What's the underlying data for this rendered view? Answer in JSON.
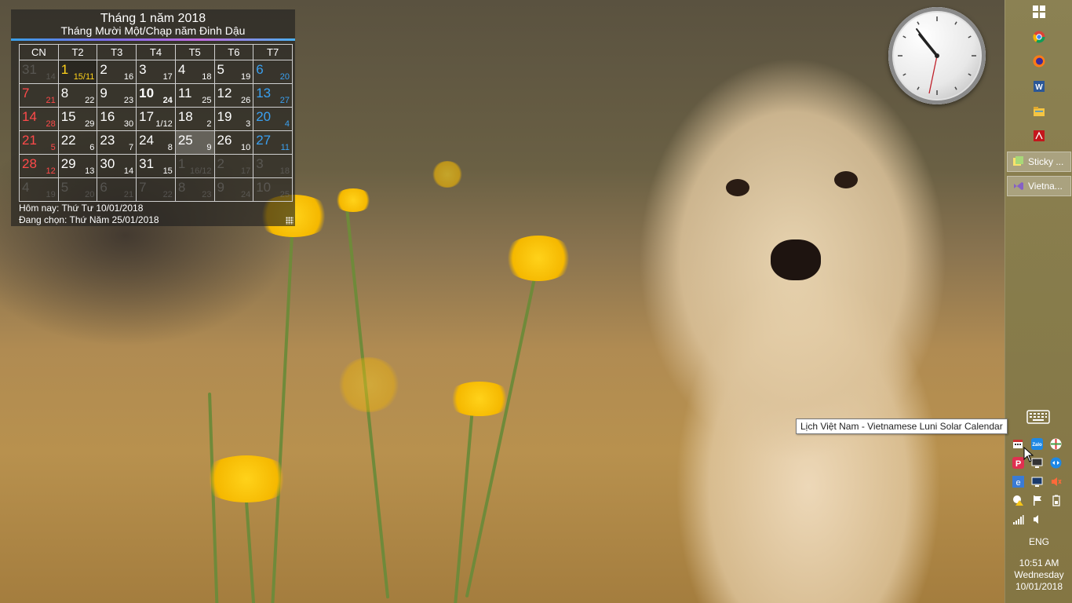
{
  "calendar": {
    "title": "Tháng 1 năm 2018",
    "subtitle": "Tháng Mười Một/Chạp năm Đinh Dậu",
    "weekdays": [
      "CN",
      "T2",
      "T3",
      "T4",
      "T5",
      "T6",
      "T7"
    ],
    "weeks": [
      [
        {
          "s": "31",
          "l": "14",
          "c": "g"
        },
        {
          "s": "1",
          "l": "15/11",
          "c": "y"
        },
        {
          "s": "2",
          "l": "16",
          "c": "w"
        },
        {
          "s": "3",
          "l": "17",
          "c": "w"
        },
        {
          "s": "4",
          "l": "18",
          "c": "w"
        },
        {
          "s": "5",
          "l": "19",
          "c": "w"
        },
        {
          "s": "6",
          "l": "20",
          "c": "b"
        }
      ],
      [
        {
          "s": "7",
          "l": "21",
          "c": "r"
        },
        {
          "s": "8",
          "l": "22",
          "c": "w"
        },
        {
          "s": "9",
          "l": "23",
          "c": "w"
        },
        {
          "s": "10",
          "l": "24",
          "c": "w"
        },
        {
          "s": "11",
          "l": "25",
          "c": "w"
        },
        {
          "s": "12",
          "l": "26",
          "c": "w"
        },
        {
          "s": "13",
          "l": "27",
          "c": "b"
        }
      ],
      [
        {
          "s": "14",
          "l": "28",
          "c": "r"
        },
        {
          "s": "15",
          "l": "29",
          "c": "w"
        },
        {
          "s": "16",
          "l": "30",
          "c": "w"
        },
        {
          "s": "17",
          "l": "1/12",
          "c": "w"
        },
        {
          "s": "18",
          "l": "2",
          "c": "w"
        },
        {
          "s": "19",
          "l": "3",
          "c": "w"
        },
        {
          "s": "20",
          "l": "4",
          "c": "b"
        }
      ],
      [
        {
          "s": "21",
          "l": "5",
          "c": "r"
        },
        {
          "s": "22",
          "l": "6",
          "c": "w"
        },
        {
          "s": "23",
          "l": "7",
          "c": "w"
        },
        {
          "s": "24",
          "l": "8",
          "c": "w"
        },
        {
          "s": "25",
          "l": "9",
          "c": "w"
        },
        {
          "s": "26",
          "l": "10",
          "c": "w"
        },
        {
          "s": "27",
          "l": "11",
          "c": "b"
        }
      ],
      [
        {
          "s": "28",
          "l": "12",
          "c": "r"
        },
        {
          "s": "29",
          "l": "13",
          "c": "w"
        },
        {
          "s": "30",
          "l": "14",
          "c": "w"
        },
        {
          "s": "31",
          "l": "15",
          "c": "w"
        },
        {
          "s": "1",
          "l": "16/12",
          "c": "g"
        },
        {
          "s": "2",
          "l": "17",
          "c": "g"
        },
        {
          "s": "3",
          "l": "18",
          "c": "g"
        }
      ],
      [
        {
          "s": "4",
          "l": "19",
          "c": "g"
        },
        {
          "s": "5",
          "l": "20",
          "c": "g"
        },
        {
          "s": "6",
          "l": "21",
          "c": "g"
        },
        {
          "s": "7",
          "l": "22",
          "c": "g"
        },
        {
          "s": "8",
          "l": "23",
          "c": "g"
        },
        {
          "s": "9",
          "l": "24",
          "c": "g"
        },
        {
          "s": "10",
          "l": "25",
          "c": "g"
        }
      ]
    ],
    "today_label": "Hôm nay: Thứ Tư 10/01/2018",
    "selected_label": "Đang chọn: Thứ Năm 25/01/2018"
  },
  "clock_gadget": {
    "time": "10:51"
  },
  "taskbar": {
    "start_icon": "windows-icon",
    "pinned": [
      "chrome-icon",
      "firefox-icon",
      "word-icon",
      "file-explorer-icon",
      "acrobat-icon"
    ],
    "apps": [
      {
        "label": "Sticky ...",
        "icon": "sticky-notes-icon"
      },
      {
        "label": "Vietna...",
        "icon": "visual-studio-icon"
      }
    ],
    "tray_icons": [
      "touch-keyboard-icon",
      "lunar-calendar-icon",
      "zalo-icon",
      "chrome-remote-icon",
      "pinterest-icon",
      "monitor-icon",
      "teamviewer-icon",
      "ie-icon",
      "display-icon",
      "volume-muted-icon",
      "warning-cloud-icon",
      "flag-icon",
      "battery-icon",
      "network-icon",
      "speaker-icon"
    ],
    "language": "ENG",
    "time": "10:51 AM",
    "day": "Wednesday",
    "date": "10/01/2018"
  },
  "tooltip": {
    "text": "Lịch Việt Nam - Vietnamese Luni Solar Calendar"
  },
  "colors": {
    "sunday": "#ff4a4a",
    "saturday": "#3aa0f0",
    "first_lunar": "#ffd21a"
  }
}
